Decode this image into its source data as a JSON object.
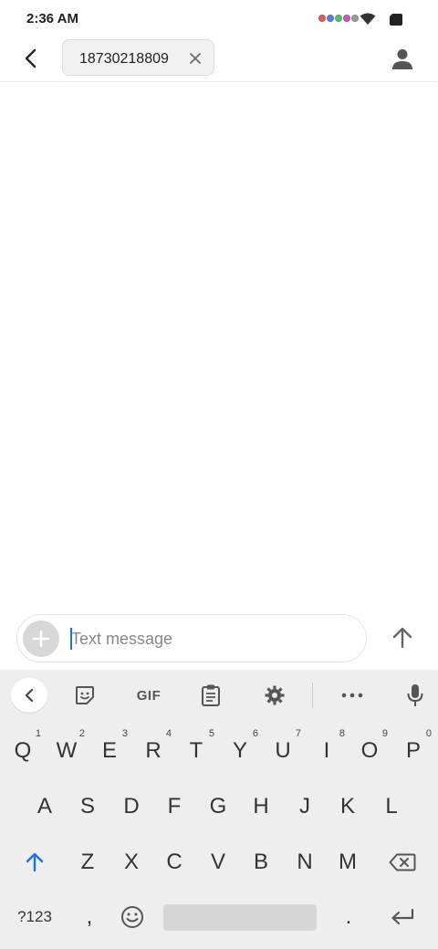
{
  "status_bar": {
    "time": "2:36 AM",
    "notification_dot_colors": [
      "#e05a5a",
      "#5a7fe0",
      "#5ac06a",
      "#c85ab8",
      "#9a9a9a"
    ],
    "icons": [
      "wifi-icon",
      "battery-icon"
    ]
  },
  "header": {
    "recipient": "18730218809",
    "icons": [
      "back-arrow-icon",
      "close-icon",
      "person-icon"
    ]
  },
  "compose": {
    "placeholder": "Text message",
    "value": "",
    "icons": [
      "plus-icon",
      "send-arrow-icon"
    ]
  },
  "keyboard": {
    "toolbar": {
      "gif_label": "GIF",
      "icons": [
        "chevron-left-icon",
        "sticker-icon",
        "clipboard-icon",
        "gear-icon",
        "more-icon",
        "microphone-icon"
      ]
    },
    "row1": [
      {
        "label": "Q",
        "hint": "1"
      },
      {
        "label": "W",
        "hint": "2"
      },
      {
        "label": "E",
        "hint": "3"
      },
      {
        "label": "R",
        "hint": "4"
      },
      {
        "label": "T",
        "hint": "5"
      },
      {
        "label": "Y",
        "hint": "6"
      },
      {
        "label": "U",
        "hint": "7"
      },
      {
        "label": "I",
        "hint": "8"
      },
      {
        "label": "O",
        "hint": "9"
      },
      {
        "label": "P",
        "hint": "0"
      }
    ],
    "row2": [
      "A",
      "S",
      "D",
      "F",
      "G",
      "H",
      "J",
      "K",
      "L"
    ],
    "row3": [
      "Z",
      "X",
      "C",
      "V",
      "B",
      "N",
      "M"
    ],
    "bottom": {
      "symbols_label": "?123",
      "comma": ",",
      "period": "."
    },
    "accent_color": "#1a73e8"
  }
}
